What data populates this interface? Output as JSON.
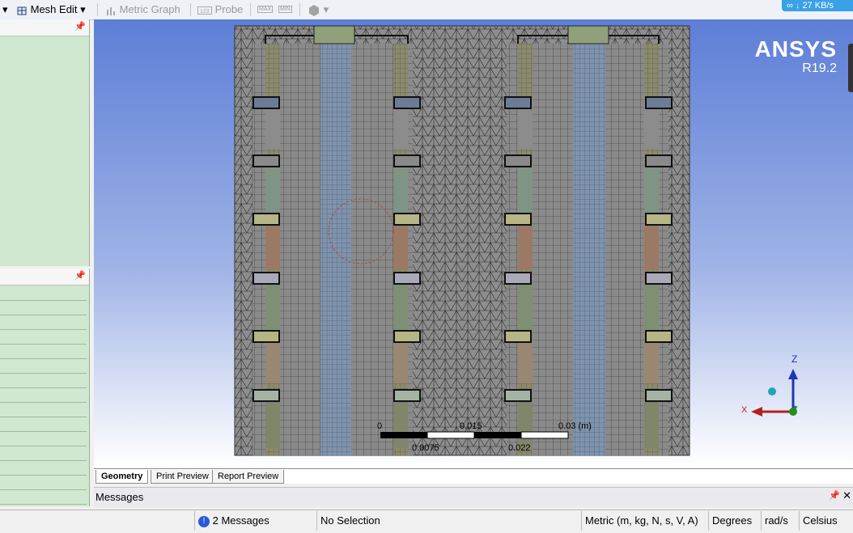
{
  "toolbar": {
    "mesh_edit": "Mesh Edit",
    "metric_graph": "Metric Graph",
    "probe": "Probe",
    "max": "MAX",
    "min": "MIN",
    "speed": "27 KB/s"
  },
  "logo": {
    "brand": "ANSYS",
    "version": "R19.2"
  },
  "scale_bar": {
    "labels_top": [
      "0",
      "0.015",
      "0.03 (m)"
    ],
    "labels_bottom": [
      "0.0075",
      "0.022"
    ]
  },
  "triad": {
    "z": "Z",
    "x": "X"
  },
  "tabs": [
    "Geometry",
    "Print Preview",
    "Report Preview"
  ],
  "messages_panel": {
    "title": "Messages"
  },
  "status": {
    "messages": "2 Messages",
    "selection": "No Selection",
    "units": "Metric (m, kg, N, s, V, A)",
    "angle": "Degrees",
    "angular_velocity": "rad/s",
    "temperature": "Celsius"
  },
  "colors": {
    "mesh_bg": "#8e8e8e",
    "accent_blue": "#5d7ed7"
  }
}
